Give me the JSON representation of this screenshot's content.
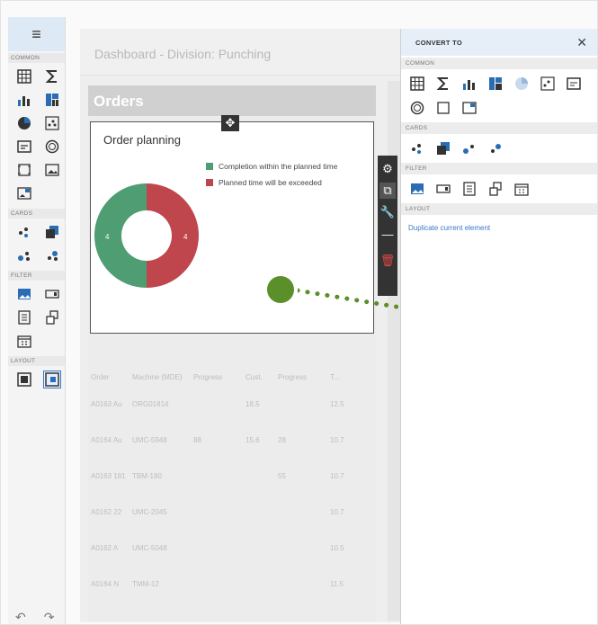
{
  "toolbox": {
    "sections": [
      "COMMON",
      "CARDS",
      "FILTER",
      "LAYOUT"
    ]
  },
  "dashboard": {
    "title": "Dashboard - Division: Punching"
  },
  "orders": {
    "header": "Orders"
  },
  "card": {
    "title": "Order planning",
    "legend": [
      {
        "label": "Completion within the planned time",
        "color": "#4f9d72"
      },
      {
        "label": "Planned time will be exceeded",
        "color": "#c0464d"
      }
    ],
    "donut_labels": {
      "left": "4",
      "right": "4"
    }
  },
  "chart_data": {
    "type": "pie",
    "categories": [
      "Completion within the planned time",
      "Planned time will be exceeded"
    ],
    "values": [
      4,
      4
    ]
  },
  "table": {
    "headers": [
      "Order",
      "Machine (MDE)",
      "Progress",
      "Cust.",
      "Progress",
      "T..."
    ],
    "rows": [
      [
        "A0163 Au",
        "ORG01814",
        "",
        "18.5",
        "",
        "12.5"
      ],
      [
        "A0164 Au",
        "UMC-5948",
        "88",
        "15.6",
        "28",
        "10.7"
      ],
      [
        "A0163 181",
        "TBM-180",
        "",
        "",
        "55",
        "10.7"
      ],
      [
        "A0162 22",
        "UMC-2045",
        "",
        "",
        "",
        "10.7"
      ],
      [
        "A0162 A",
        "UMC-5048",
        "",
        "",
        "",
        "10.5"
      ],
      [
        "A0164 N",
        "TMM-12",
        "",
        "",
        "",
        "11.5"
      ]
    ]
  },
  "convert": {
    "title": "CONVERT TO",
    "close": "✕",
    "sections": [
      "COMMON",
      "CARDS",
      "FILTER",
      "LAYOUT"
    ],
    "duplicate_link": "Duplicate current element"
  },
  "colors": {
    "accent": "#3b79c7",
    "green": "#4f9d72",
    "red": "#c0464d",
    "annotation": "#5a8f2a"
  }
}
